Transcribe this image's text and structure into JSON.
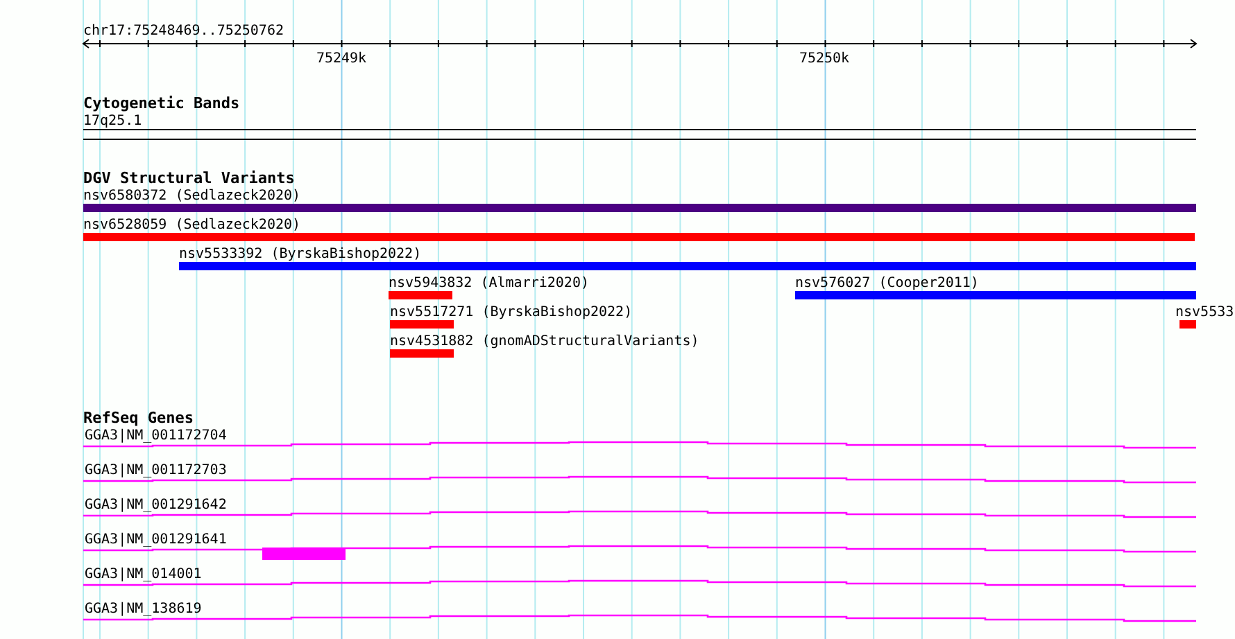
{
  "ruler": {
    "location": "chr17:75248469..75250762",
    "ticks": [
      "75249k",
      "75250k"
    ]
  },
  "tracks": [
    {
      "kind": "bands",
      "title": "Cytogenetic Bands",
      "features": [
        {
          "label": "17q25.1"
        }
      ]
    },
    {
      "kind": "variants",
      "title": "DGV Structural Variants",
      "features": [
        {
          "label": "nsv6580372 (Sedlazeck2020)",
          "color": "#4b0082"
        },
        {
          "label": "nsv6528059 (Sedlazeck2020)",
          "color": "#ff0000"
        },
        {
          "label": "nsv5533392 (ByrskaBishop2022)",
          "color": "#0000ff"
        },
        {
          "label": "nsv5943832 (Almarri2020)",
          "color": "#ff0000"
        },
        {
          "label": "nsv576027 (Cooper2011)",
          "color": "#0000ff"
        },
        {
          "label": "nsv5517271 (ByrskaBishop2022)",
          "color": "#ff0000"
        },
        {
          "label": "nsv5533",
          "color": "#ff0000"
        },
        {
          "label": "nsv4531882 (gnomADStructuralVariants)",
          "color": "#ff0000"
        }
      ]
    },
    {
      "kind": "genes",
      "title": "RefSeq Genes",
      "features": [
        {
          "label": "GGA3|NM_001172704"
        },
        {
          "label": "GGA3|NM_001172703"
        },
        {
          "label": "GGA3|NM_001291642"
        },
        {
          "label": "GGA3|NM_001291641"
        },
        {
          "label": "GGA3|NM_014001"
        },
        {
          "label": "GGA3|NM_138619"
        }
      ]
    }
  ]
}
